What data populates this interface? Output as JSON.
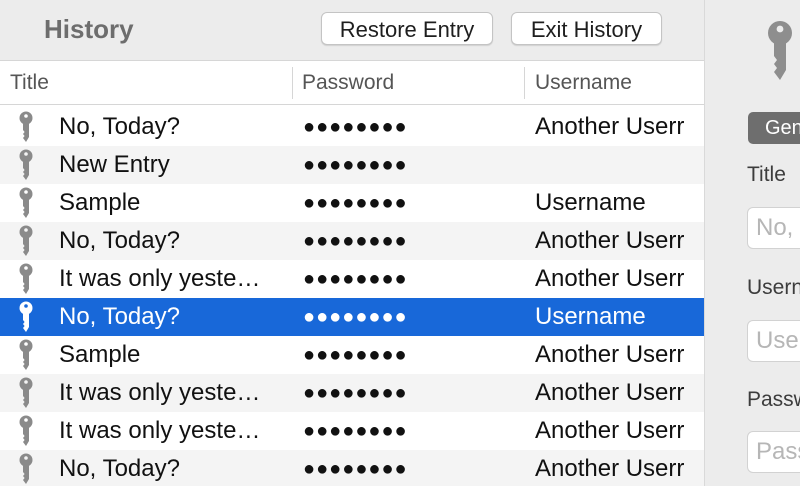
{
  "history": {
    "title": "History",
    "restore_label": "Restore Entry",
    "exit_label": "Exit History"
  },
  "table": {
    "columns": [
      "Title",
      "Password",
      "Username"
    ],
    "rows": [
      {
        "title": "No, Today?",
        "password": "●●●●●●●●",
        "username": "Another Userr",
        "selected": false
      },
      {
        "title": "New Entry",
        "password": "●●●●●●●●",
        "username": "",
        "selected": false
      },
      {
        "title": "Sample",
        "password": "●●●●●●●●",
        "username": "Username",
        "selected": false
      },
      {
        "title": "No, Today?",
        "password": "●●●●●●●●",
        "username": "Another Userr",
        "selected": false
      },
      {
        "title": "It was only yeste…",
        "password": "●●●●●●●●",
        "username": "Another Userr",
        "selected": false
      },
      {
        "title": "No, Today?",
        "password": "●●●●●●●●",
        "username": "Username",
        "selected": true
      },
      {
        "title": "Sample",
        "password": "●●●●●●●●",
        "username": "Another Userr",
        "selected": false
      },
      {
        "title": "It was only yeste…",
        "password": "●●●●●●●●",
        "username": "Another Userr",
        "selected": false
      },
      {
        "title": "It was only yeste…",
        "password": "●●●●●●●●",
        "username": "Another Userr",
        "selected": false
      },
      {
        "title": "No, Today?",
        "password": "●●●●●●●●",
        "username": "Another Userr",
        "selected": false
      }
    ],
    "row_icon": "key-icon"
  },
  "detail": {
    "icon": "key-icon",
    "tab_label": "General",
    "title_label": "Title",
    "title_placeholder": "No, Today?",
    "username_label": "Username",
    "username_placeholder": "Username",
    "password_label": "Password",
    "password_placeholder": "Password"
  },
  "colors": {
    "selection": "#1868d9",
    "icon_gray": "#8a8a8a",
    "tab_bg": "#6e6e6e"
  }
}
